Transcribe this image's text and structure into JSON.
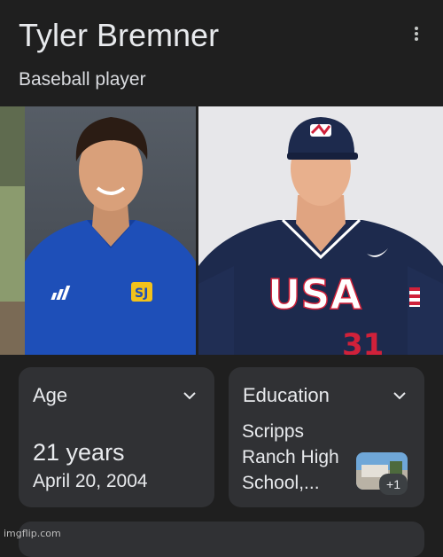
{
  "header": {
    "title": "Tyler Bremner",
    "subtitle": "Baseball player"
  },
  "images": {
    "photo_1_alt": "Tyler Bremner in blue polo",
    "photo_2_alt": "Tyler Bremner in USA baseball uniform",
    "jersey_text": "USA",
    "jersey_number": "31"
  },
  "cards": {
    "age": {
      "label": "Age",
      "value": "21 years",
      "date": "April 20, 2004"
    },
    "education": {
      "label": "Education",
      "value": "Scripps Ranch High School,...",
      "more_count": "+1"
    }
  },
  "watermark": "imgflip.com",
  "colors": {
    "background": "#1f1f1f",
    "card": "#303134",
    "text": "#e8eaed",
    "polo_blue": "#1e4fb8",
    "usa_navy": "#1d2a4d",
    "usa_red": "#d0213a"
  }
}
